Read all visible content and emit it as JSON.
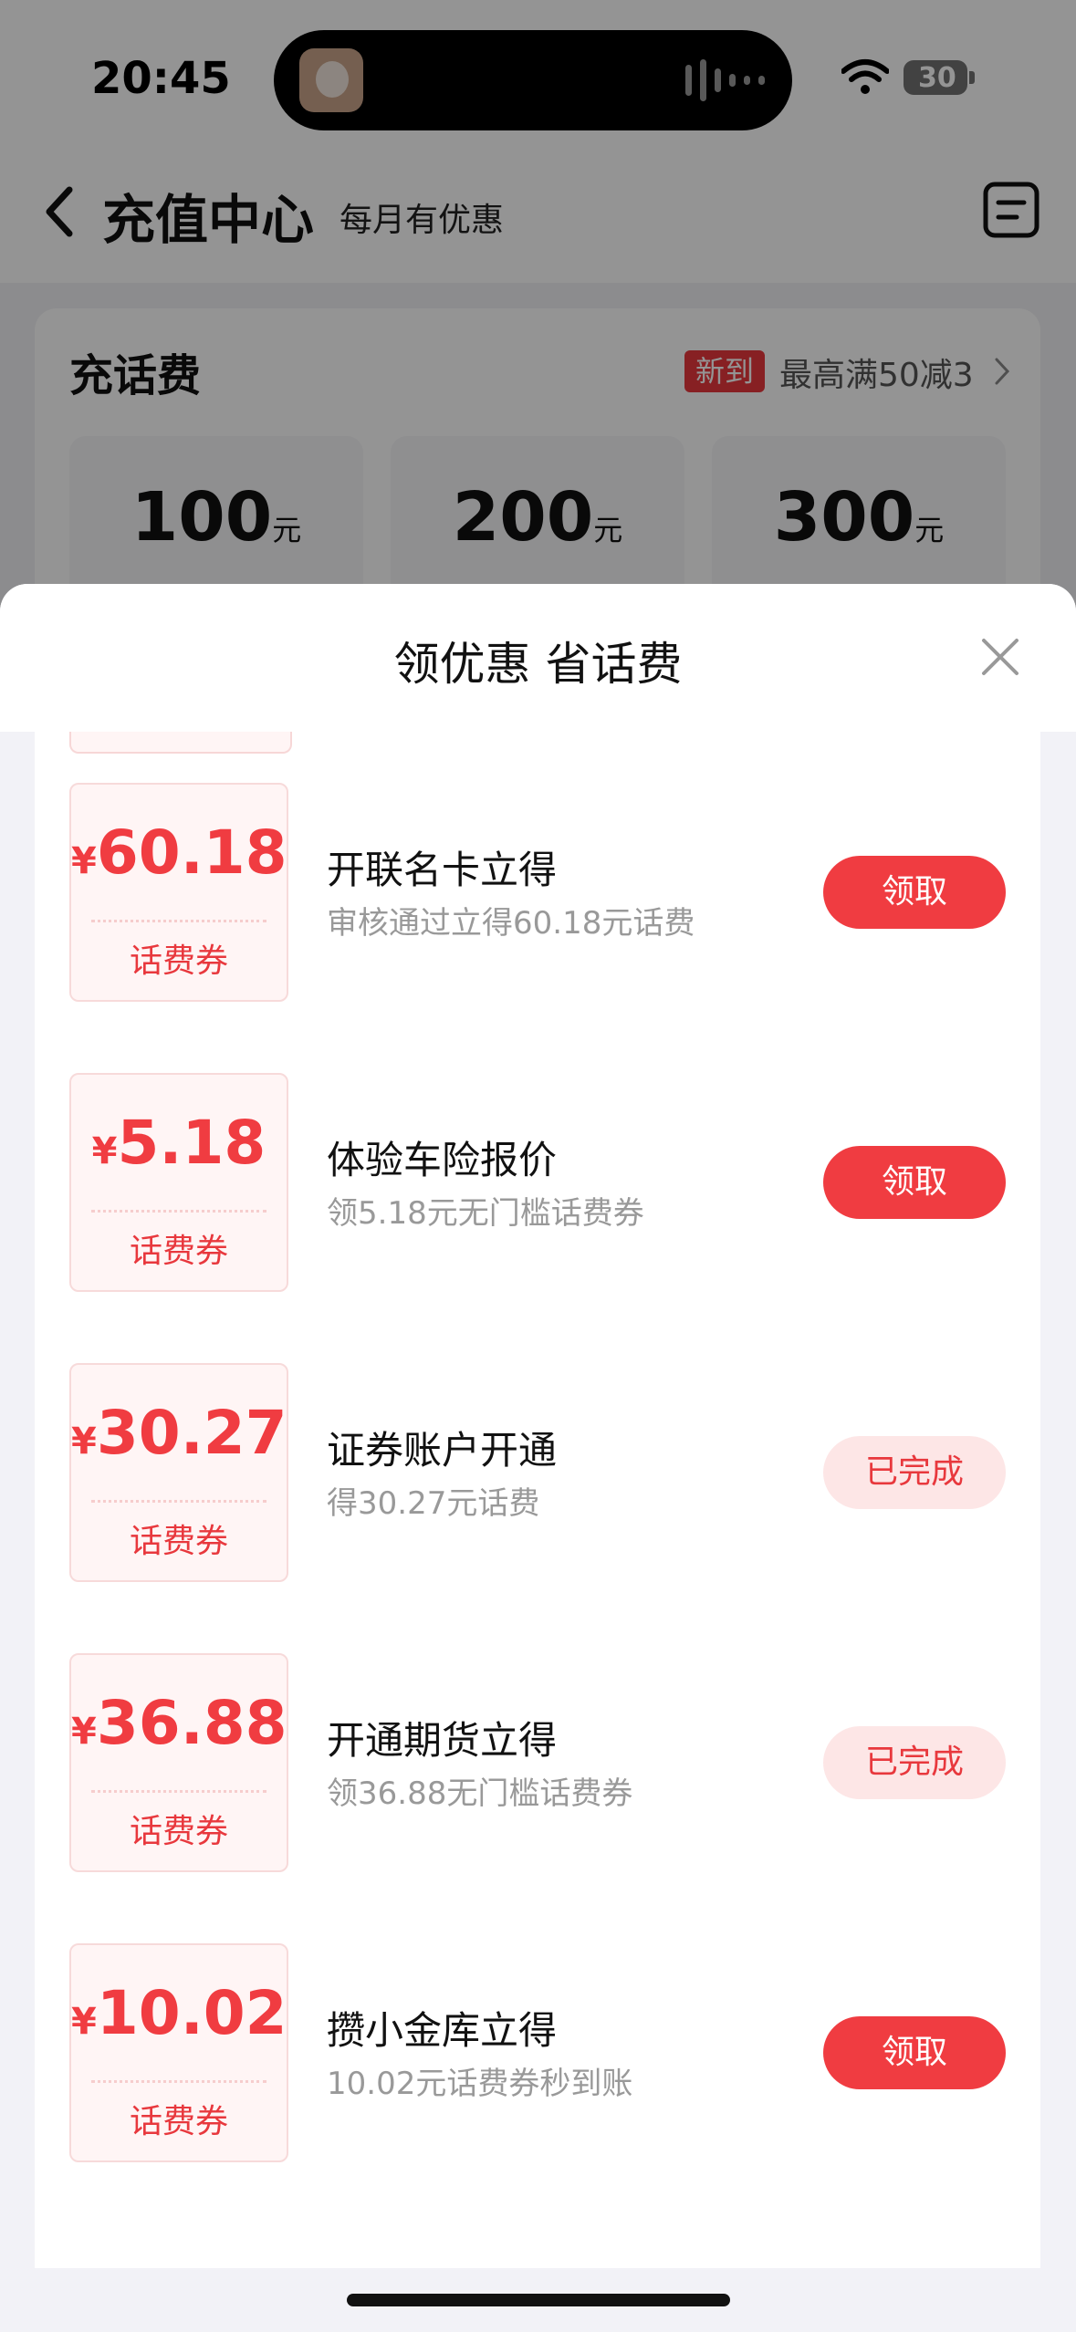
{
  "status_bar": {
    "time": "20:45",
    "battery": "30"
  },
  "header": {
    "title": "充值中心",
    "subtitle": "每月有优惠"
  },
  "topup": {
    "title": "充话费",
    "promo_badge": "新到",
    "promo_text": "最高满50减3",
    "amounts": [
      {
        "value": "100",
        "unit": "元"
      },
      {
        "value": "200",
        "unit": "元"
      },
      {
        "value": "300",
        "unit": "元"
      }
    ]
  },
  "sheet": {
    "title": "领优惠 省话费",
    "currency": "¥",
    "coupon_label": "话费券",
    "offers": [
      {
        "amount": "60.18",
        "title": "开联名卡立得",
        "desc": "审核通过立得60.18元话费",
        "button": "领取",
        "status": "claim"
      },
      {
        "amount": "5.18",
        "title": "体验车险报价",
        "desc": "领5.18元无门槛话费券",
        "button": "领取",
        "status": "claim"
      },
      {
        "amount": "30.27",
        "title": "证券账户开通",
        "desc": "得30.27元话费",
        "button": "已完成",
        "status": "done"
      },
      {
        "amount": "36.88",
        "title": "开通期货立得",
        "desc": "领36.88无门槛话费券",
        "button": "已完成",
        "status": "done"
      },
      {
        "amount": "10.02",
        "title": "攒小金库立得",
        "desc": "10.02元话费券秒到账",
        "button": "领取",
        "status": "claim"
      }
    ]
  },
  "colors": {
    "accent": "#f03c41",
    "done_bg": "#fde6e6",
    "coupon_bg": "#fff5f5"
  },
  "icons": {
    "back": "chevron-left-icon",
    "menu": "list-menu-icon",
    "close": "close-icon",
    "wifi": "wifi-icon",
    "battery": "battery-icon"
  }
}
